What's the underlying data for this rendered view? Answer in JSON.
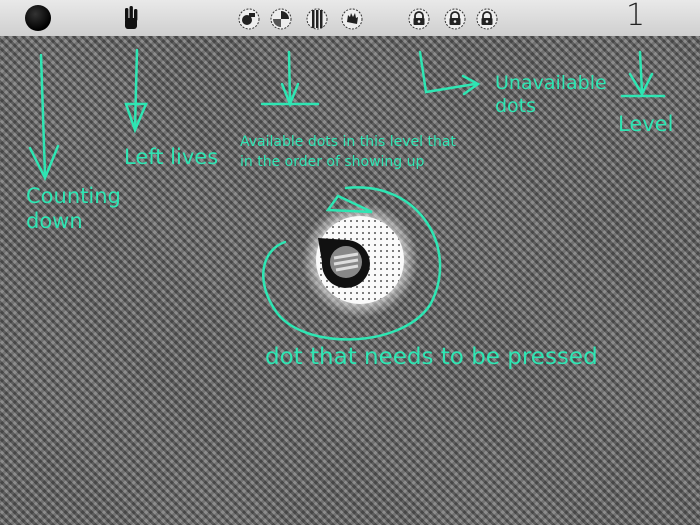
{
  "hud": {
    "level": "1",
    "lives_icon": "hand-three-fingers-icon",
    "timer_icon": "countdown-dot-icon",
    "available_dots": [
      "camera-dot-icon",
      "pie-dot-icon",
      "stripe-dot-icon",
      "hand-dot-icon"
    ],
    "unavailable_dots": [
      "lock-dot-icon",
      "lock-dot-icon",
      "lock-dot-icon"
    ]
  },
  "annotations": {
    "counting_down": [
      "Counting",
      "down"
    ],
    "left_lives": "Left lives",
    "available_dots": [
      "Available dots in this level that",
      "in the order of showing up"
    ],
    "unavailable_dots": [
      "Unavailable",
      "dots"
    ],
    "level": "Level",
    "target": "dot that needs to be pressed"
  },
  "colors": {
    "annotation": "#2ee6b3",
    "hud_background": "#dddddd",
    "field_background": "#777777"
  }
}
